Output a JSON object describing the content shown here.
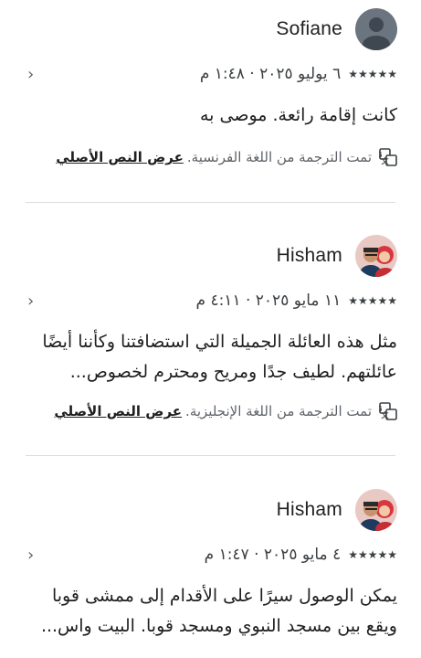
{
  "reviews": [
    {
      "name": "Sofiane",
      "rating_stars": "★★★★★",
      "rating": 5,
      "date": "٦ يوليو ٢٠٢٥ · ١:٤٨ م",
      "text": "كانت إقامة رائعة. موصى به",
      "translated_note": "تمت الترجمة من اللغة الفرنسية.",
      "show_original": "عرض النص الأصلي",
      "avatar_icon": "default-avatar-icon"
    },
    {
      "name": "Hisham",
      "rating_stars": "★★★★★",
      "rating": 5,
      "date": "١١ مايو ٢٠٢٥ · ٤:١١ م",
      "text": "مثل هذه العائلة الجميلة التي استضافتنا وكأننا أيضًا عائلتهم. لطيف جدًا ومريح ومحترم لخصوص...",
      "translated_note": "تمت الترجمة من اللغة الإنجليزية.",
      "show_original": "عرض النص الأصلي",
      "avatar_icon": "user-photo-avatar"
    },
    {
      "name": "Hisham",
      "rating_stars": "★★★★★",
      "rating": 5,
      "date": "٤ مايو ٢٠٢٥ · ١:٤٧ م",
      "text": "يمكن الوصول سيرًا على الأقدام إلى ممشى قوبا ويقع بين مسجد النبوي ومسجد قوبا. البيت واس...",
      "avatar_icon": "user-photo-avatar"
    }
  ],
  "chevron_icon": "chevron-left-icon",
  "translate_icon": "translate-icon",
  "colors": {
    "text": "#1f1f1f",
    "muted": "#5f6368",
    "divider": "#dcdcdc"
  }
}
